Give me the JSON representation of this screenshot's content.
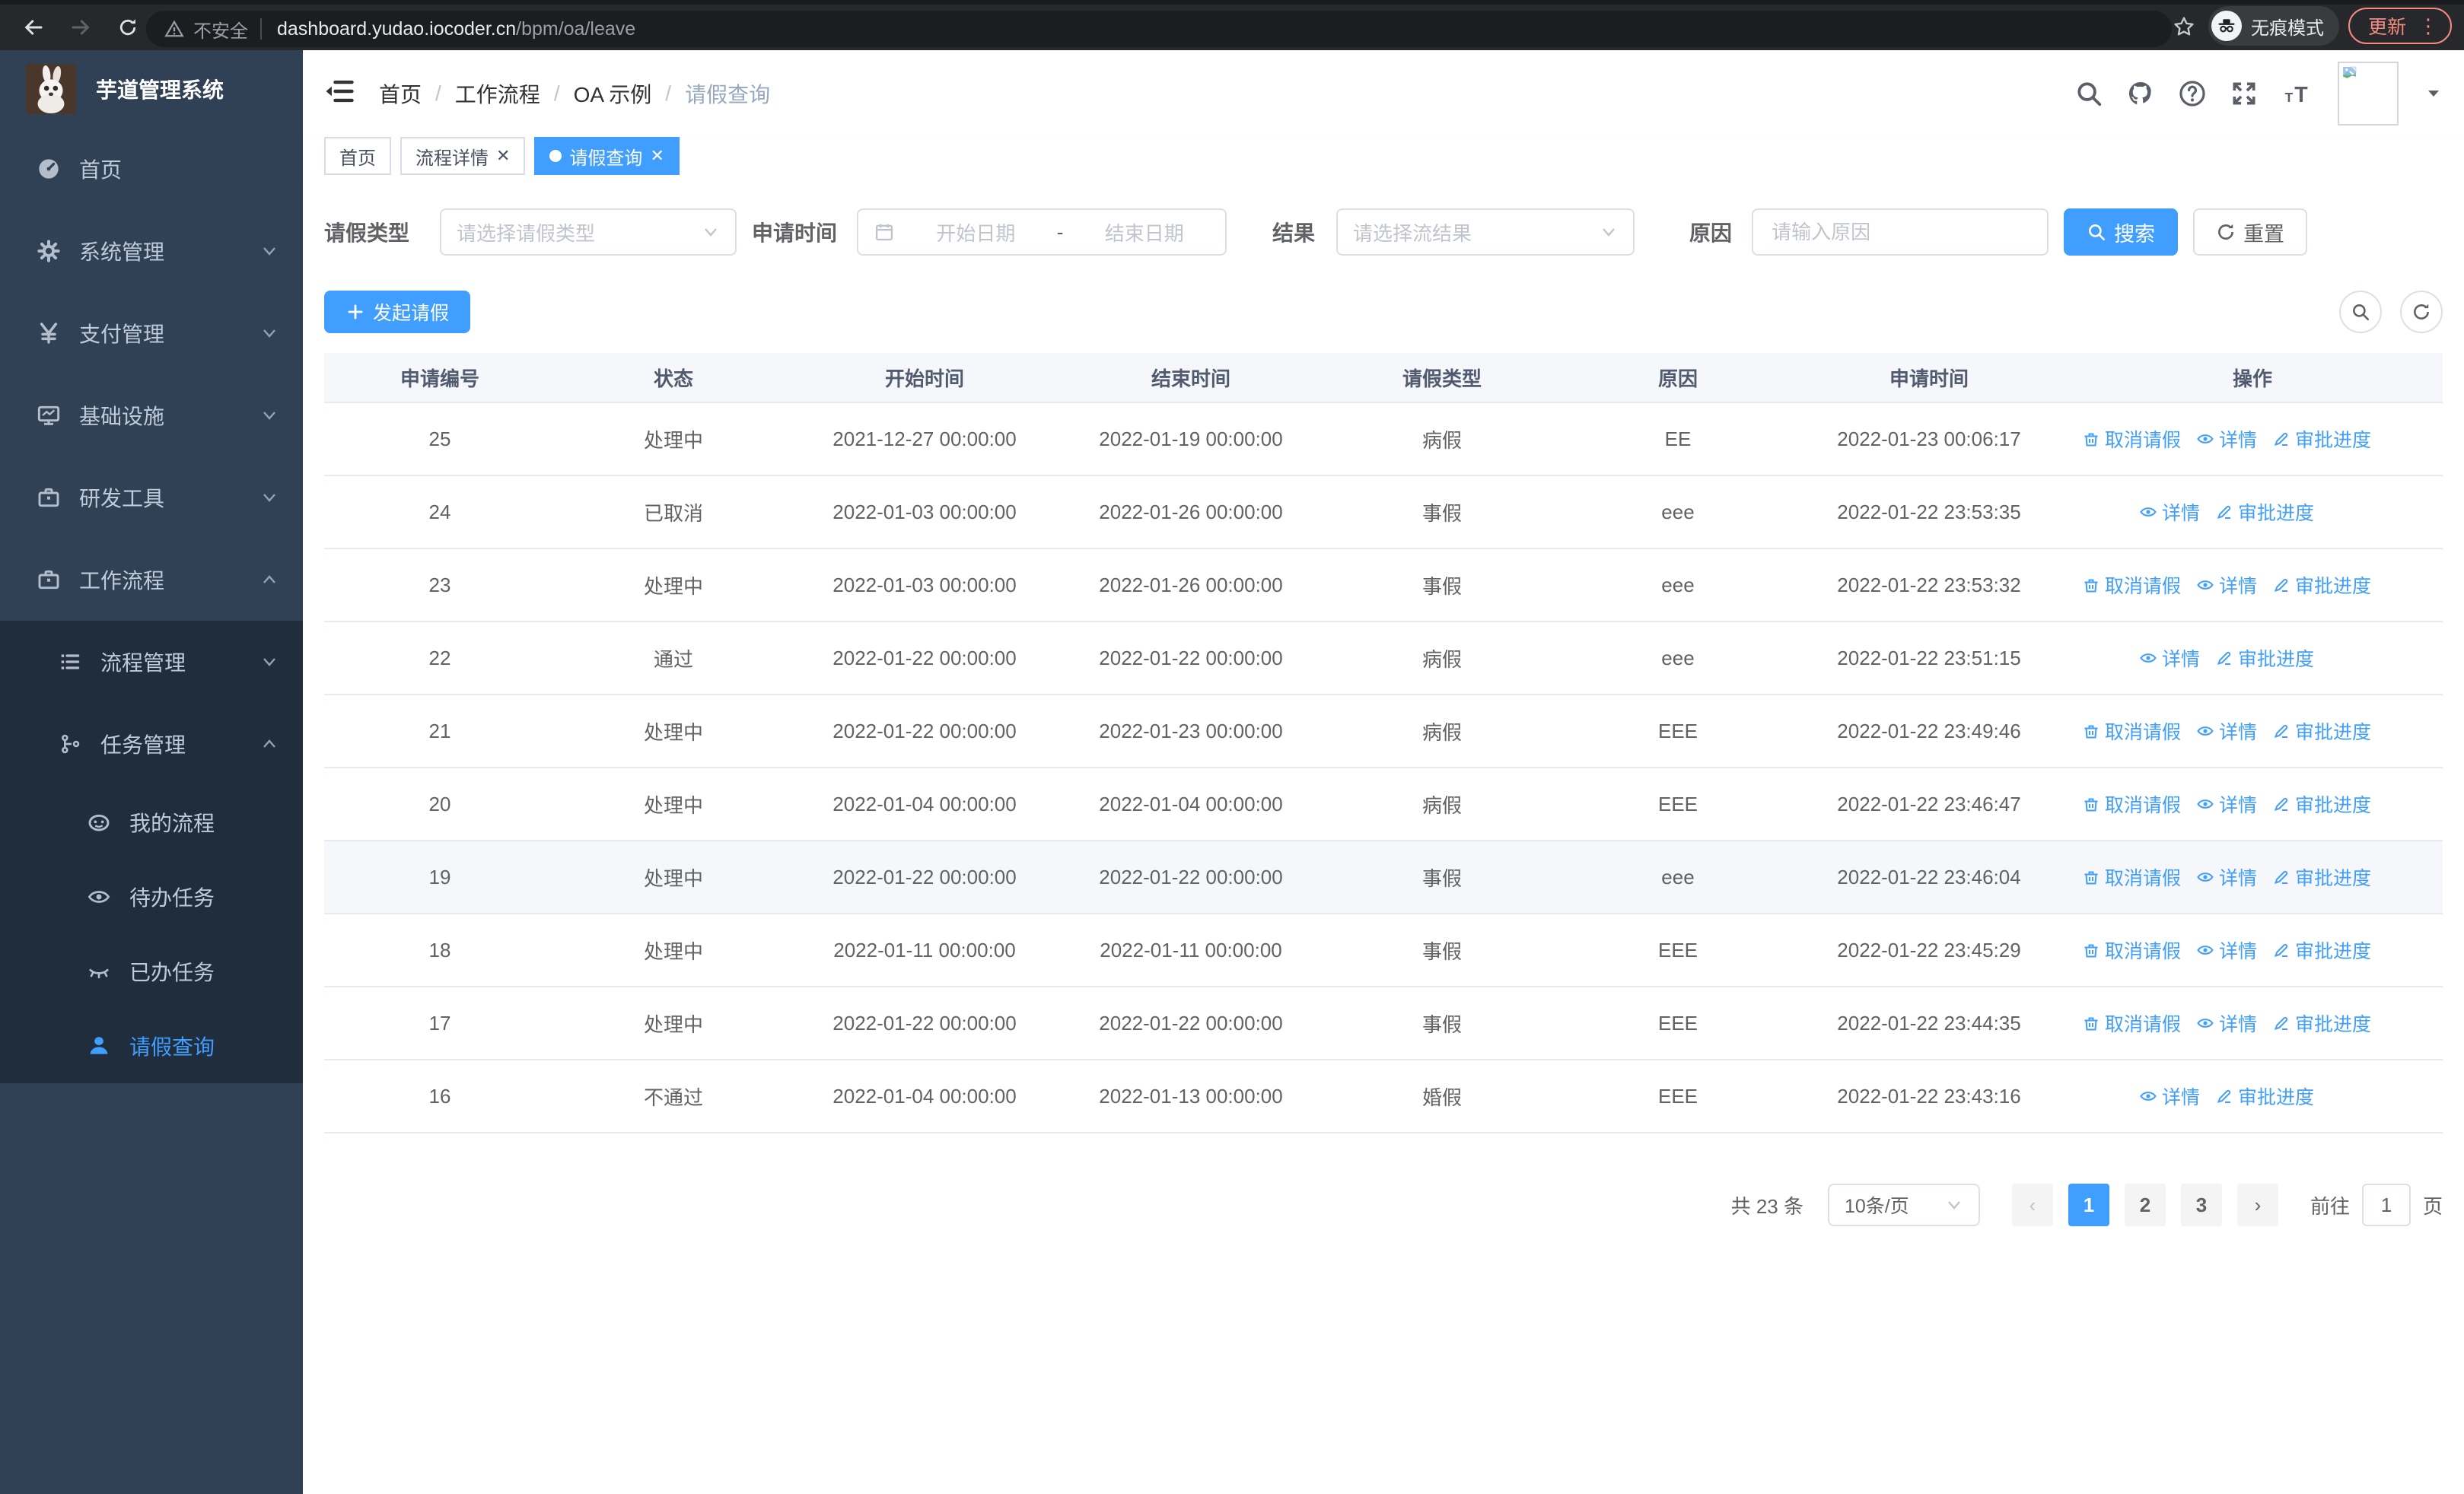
{
  "colors": {
    "primary": "#409eff",
    "sidebar_bg": "#304156",
    "submenu_bg": "#1f2d3d",
    "danger_chip": "#f28b82"
  },
  "browser": {
    "security_label": "不安全",
    "url_host": "dashboard.yudao.iocoder.cn",
    "url_path": "/bpm/oa/leave",
    "incognito_label": "无痕模式",
    "update_label": "更新"
  },
  "sidebar": {
    "title": "芋道管理系统",
    "items": [
      {
        "key": "home",
        "label": "首页",
        "icon": "dashboard",
        "level": 1
      },
      {
        "key": "system",
        "label": "系统管理",
        "icon": "gear",
        "level": 1,
        "chevron": "down"
      },
      {
        "key": "pay",
        "label": "支付管理",
        "icon": "yen",
        "level": 1,
        "chevron": "down"
      },
      {
        "key": "infra",
        "label": "基础设施",
        "icon": "monitor",
        "level": 1,
        "chevron": "down"
      },
      {
        "key": "devtool",
        "label": "研发工具",
        "icon": "briefcase",
        "level": 1,
        "chevron": "down"
      },
      {
        "key": "workflow",
        "label": "工作流程",
        "icon": "briefcase",
        "level": 1,
        "chevron": "up"
      },
      {
        "key": "process-mgmt",
        "label": "流程管理",
        "icon": "list",
        "level": 2,
        "chevron": "down",
        "sub": true
      },
      {
        "key": "task-mgmt",
        "label": "任务管理",
        "icon": "branch",
        "level": 2,
        "chevron": "up",
        "sub": true
      },
      {
        "key": "my-process",
        "label": "我的流程",
        "icon": "face",
        "level": 3,
        "sub": true
      },
      {
        "key": "todo-task",
        "label": "待办任务",
        "icon": "eye",
        "level": 3,
        "sub": true
      },
      {
        "key": "done-task",
        "label": "已办任务",
        "icon": "eye-closed",
        "level": 3,
        "sub": true
      },
      {
        "key": "leave-query",
        "label": "请假查询",
        "icon": "user",
        "level": 3,
        "sub": true,
        "active": true
      }
    ]
  },
  "header": {
    "breadcrumb": [
      "首页",
      "工作流程",
      "OA 示例",
      "请假查询"
    ]
  },
  "tabs": [
    {
      "label": "首页"
    },
    {
      "label": "流程详情",
      "closable": true
    },
    {
      "label": "请假查询",
      "closable": true,
      "active": true
    }
  ],
  "filters": {
    "type_label": "请假类型",
    "type_placeholder": "请选择请假类型",
    "apply_time_label": "申请时间",
    "date_start_placeholder": "开始日期",
    "date_separator": "-",
    "date_end_placeholder": "结束日期",
    "result_label": "结果",
    "result_placeholder": "请选择流结果",
    "reason_label": "原因",
    "reason_placeholder": "请输入原因",
    "search_label": "搜索",
    "reset_label": "重置"
  },
  "toolbar": {
    "create_label": "发起请假"
  },
  "table": {
    "headers": [
      "申请编号",
      "状态",
      "开始时间",
      "结束时间",
      "请假类型",
      "原因",
      "申请时间",
      "操作"
    ],
    "rows": [
      {
        "id": "25",
        "status": "处理中",
        "start": "2021-12-27 00:00:00",
        "end": "2022-01-19 00:00:00",
        "type": "病假",
        "reason": "EE",
        "apply": "2022-01-23 00:06:17",
        "actions": [
          "cancel",
          "detail",
          "progress"
        ]
      },
      {
        "id": "24",
        "status": "已取消",
        "start": "2022-01-03 00:00:00",
        "end": "2022-01-26 00:00:00",
        "type": "事假",
        "reason": "eee",
        "apply": "2022-01-22 23:53:35",
        "actions": [
          "detail",
          "progress"
        ]
      },
      {
        "id": "23",
        "status": "处理中",
        "start": "2022-01-03 00:00:00",
        "end": "2022-01-26 00:00:00",
        "type": "事假",
        "reason": "eee",
        "apply": "2022-01-22 23:53:32",
        "actions": [
          "cancel",
          "detail",
          "progress"
        ]
      },
      {
        "id": "22",
        "status": "通过",
        "start": "2022-01-22 00:00:00",
        "end": "2022-01-22 00:00:00",
        "type": "病假",
        "reason": "eee",
        "apply": "2022-01-22 23:51:15",
        "actions": [
          "detail",
          "progress"
        ]
      },
      {
        "id": "21",
        "status": "处理中",
        "start": "2022-01-22 00:00:00",
        "end": "2022-01-23 00:00:00",
        "type": "病假",
        "reason": "EEE",
        "apply": "2022-01-22 23:49:46",
        "actions": [
          "cancel",
          "detail",
          "progress"
        ]
      },
      {
        "id": "20",
        "status": "处理中",
        "start": "2022-01-04 00:00:00",
        "end": "2022-01-04 00:00:00",
        "type": "病假",
        "reason": "EEE",
        "apply": "2022-01-22 23:46:47",
        "actions": [
          "cancel",
          "detail",
          "progress"
        ]
      },
      {
        "id": "19",
        "status": "处理中",
        "start": "2022-01-22 00:00:00",
        "end": "2022-01-22 00:00:00",
        "type": "事假",
        "reason": "eee",
        "apply": "2022-01-22 23:46:04",
        "actions": [
          "cancel",
          "detail",
          "progress"
        ],
        "highlight": true
      },
      {
        "id": "18",
        "status": "处理中",
        "start": "2022-01-11 00:00:00",
        "end": "2022-01-11 00:00:00",
        "type": "事假",
        "reason": "EEE",
        "apply": "2022-01-22 23:45:29",
        "actions": [
          "cancel",
          "detail",
          "progress"
        ]
      },
      {
        "id": "17",
        "status": "处理中",
        "start": "2022-01-22 00:00:00",
        "end": "2022-01-22 00:00:00",
        "type": "事假",
        "reason": "EEE",
        "apply": "2022-01-22 23:44:35",
        "actions": [
          "cancel",
          "detail",
          "progress"
        ]
      },
      {
        "id": "16",
        "status": "不通过",
        "start": "2022-01-04 00:00:00",
        "end": "2022-01-13 00:00:00",
        "type": "婚假",
        "reason": "EEE",
        "apply": "2022-01-22 23:43:16",
        "actions": [
          "detail",
          "progress"
        ]
      }
    ]
  },
  "actions": {
    "cancel": "取消请假",
    "detail": "详情",
    "progress": "审批进度"
  },
  "pagination": {
    "total": "共 23 条",
    "page_size": "10条/页",
    "pages": [
      "1",
      "2",
      "3"
    ],
    "current_page": "1",
    "goto_label": "前往",
    "goto_value": "1",
    "unit_label": "页"
  }
}
